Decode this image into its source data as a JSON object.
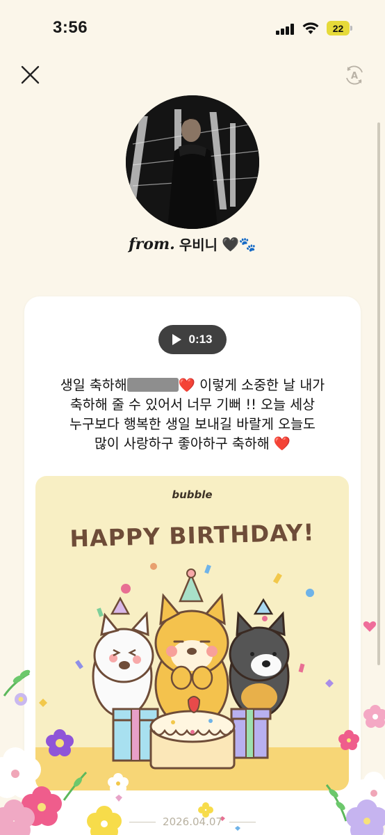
{
  "status_bar": {
    "time": "3:56",
    "battery_level": "22",
    "battery_color": "#e6da3a"
  },
  "header": {
    "close_icon": "close-icon",
    "translate_icon": "translate-icon"
  },
  "profile": {
    "from_label": "from.",
    "sender_name": "우비니",
    "name_emojis": "🖤🐾"
  },
  "message": {
    "audio_duration": "0:13",
    "line1_a": "생일 축하해",
    "line1_b": "❤️ 이렇게 소중한 날 내가",
    "line2": "축하해 줄 수 있어서 너무 기뻐 !! 오늘 세상",
    "line3": "누구보다 행복한 생일 보내길 바랄게 오늘도",
    "line4": "많이 사랑하구 좋아하구 축하해 ❤️"
  },
  "birthday_card": {
    "brand": "bubble",
    "title": "HAPPY BIRTHDAY!",
    "background": "#f8efc4",
    "title_color": "#6e4c38"
  },
  "footer": {
    "date": "2026.04.07"
  }
}
